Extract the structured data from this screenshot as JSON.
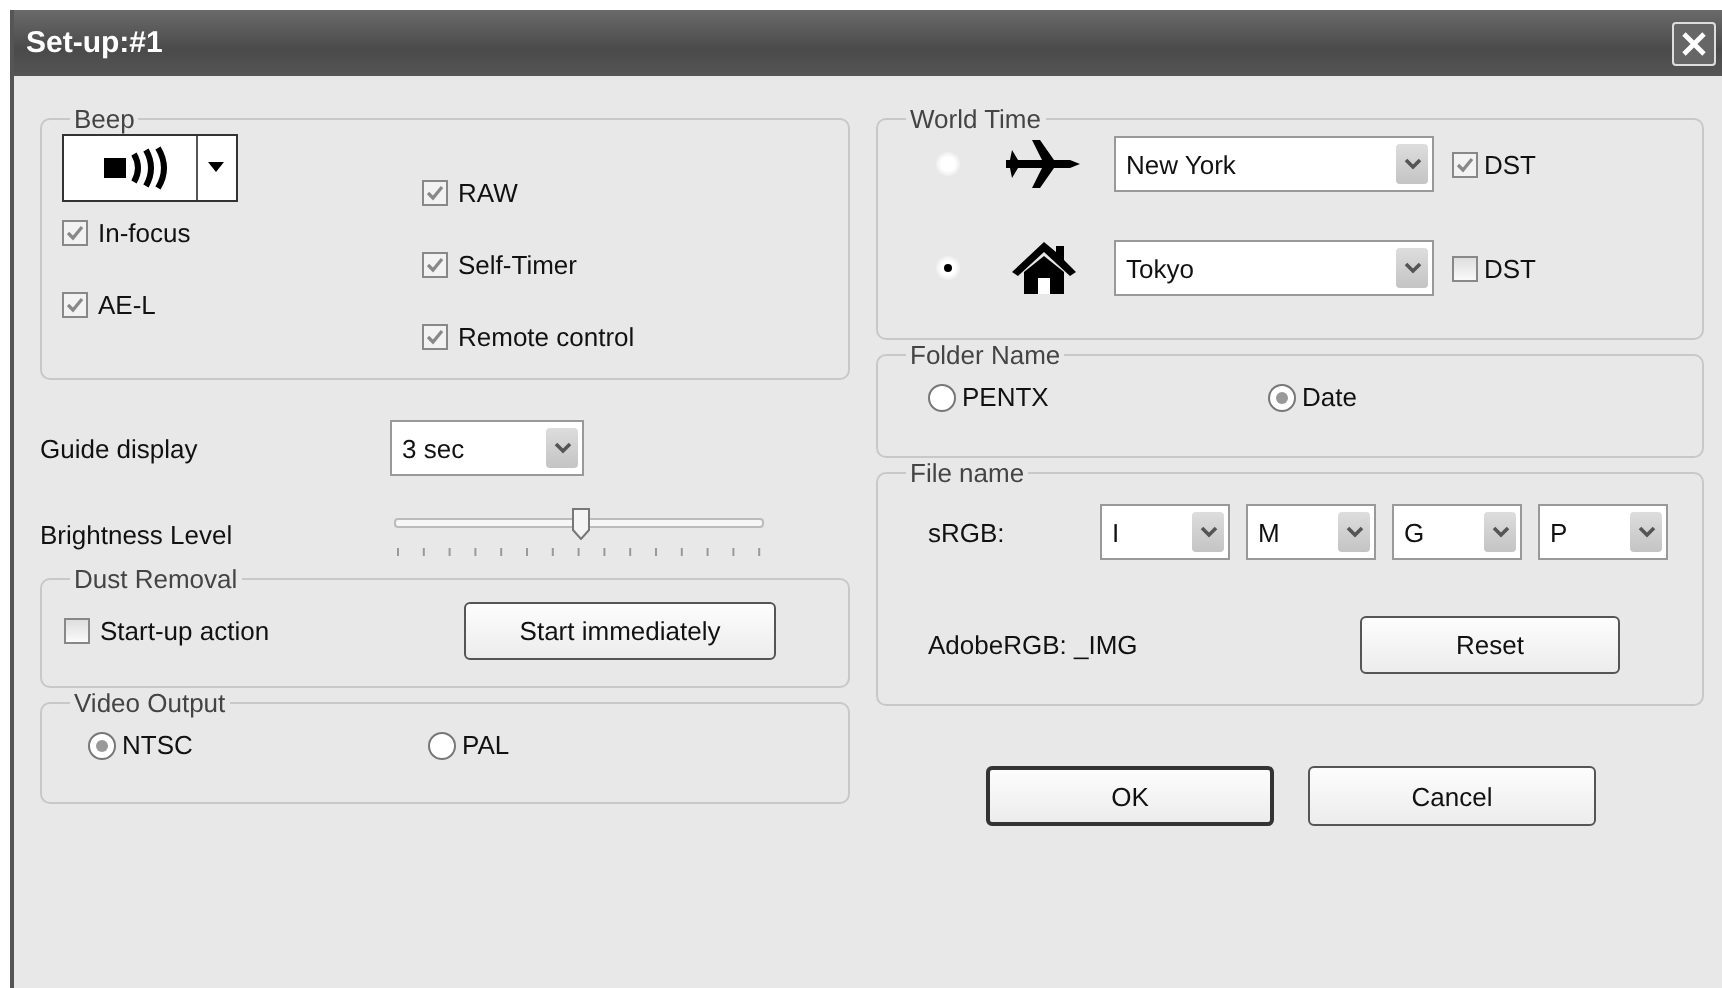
{
  "window": {
    "title": "Set-up:#1"
  },
  "beep": {
    "title": "Beep",
    "left_checkboxes": [
      {
        "label": "In-focus",
        "checked": true
      },
      {
        "label": "AE-L",
        "checked": true
      }
    ],
    "right_checkboxes": [
      {
        "label": "RAW",
        "checked": true
      },
      {
        "label": "Self-Timer",
        "checked": true
      },
      {
        "label": "Remote control",
        "checked": true
      }
    ]
  },
  "guide_display": {
    "label": "Guide display",
    "value": "3 sec"
  },
  "brightness": {
    "label": "Brightness Level",
    "level": 0.5
  },
  "dust_removal": {
    "title": "Dust Removal",
    "checkbox": {
      "label": "Start-up action",
      "checked": false
    },
    "button": "Start immediately"
  },
  "video_output": {
    "title": "Video Output",
    "options": [
      {
        "label": "NTSC",
        "selected": true
      },
      {
        "label": "PAL",
        "selected": false
      }
    ]
  },
  "world_time": {
    "title": "World Time",
    "rows": [
      {
        "kind": "travel",
        "selected": false,
        "city": "New York",
        "dst_label": "DST",
        "dst_checked": true
      },
      {
        "kind": "home",
        "selected": true,
        "city": "Tokyo",
        "dst_label": "DST",
        "dst_checked": false
      }
    ]
  },
  "folder_name": {
    "title": "Folder Name",
    "options": [
      {
        "label": "PENTX",
        "selected": false
      },
      {
        "label": "Date",
        "selected": true
      }
    ]
  },
  "file_name": {
    "title": "File name",
    "srgb_label": "sRGB:",
    "fields": [
      "I",
      "M",
      "G",
      "P"
    ],
    "adobe_label": "AdobeRGB: _IMG",
    "reset_button": "Reset"
  },
  "buttons": [
    "OK",
    "Cancel"
  ]
}
